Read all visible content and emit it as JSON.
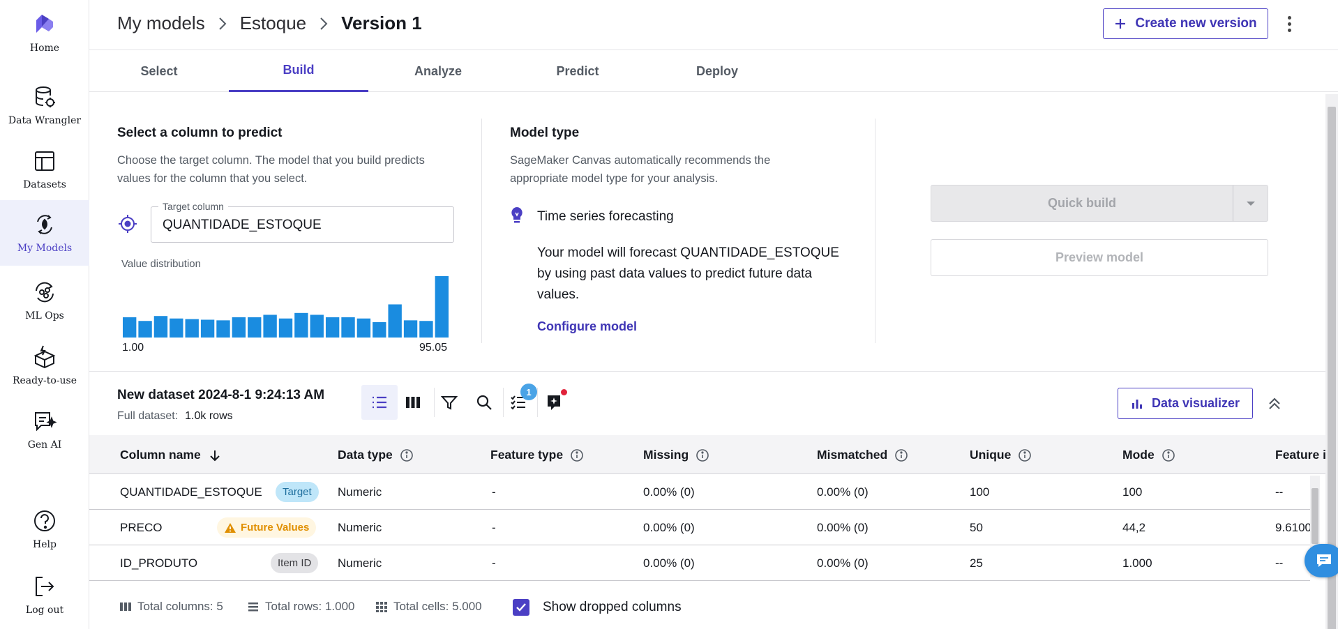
{
  "nav": {
    "items": [
      {
        "label": "Home",
        "icon": "home-logo-icon"
      },
      {
        "label": "Data Wrangler",
        "icon": "data-wrangler-icon"
      },
      {
        "label": "Datasets",
        "icon": "datasets-icon"
      },
      {
        "label": "My Models",
        "icon": "my-models-icon",
        "active": true
      },
      {
        "label": "ML Ops",
        "icon": "ml-ops-icon"
      },
      {
        "label": "Ready-to-use",
        "icon": "ready-to-use-icon"
      },
      {
        "label": "Gen AI",
        "icon": "gen-ai-icon"
      },
      {
        "label": "Help",
        "icon": "help-icon"
      },
      {
        "label": "Log out",
        "icon": "logout-icon"
      }
    ]
  },
  "header": {
    "breadcrumb": [
      "My models",
      "Estoque",
      "Version 1"
    ],
    "create_button": "Create new version"
  },
  "tabs": [
    "Select",
    "Build",
    "Analyze",
    "Predict",
    "Deploy"
  ],
  "active_tab": "Build",
  "predict_panel": {
    "title": "Select a column to predict",
    "description": "Choose the target column. The model that you build predicts values for the column that you select.",
    "target_label": "Target column",
    "target_value": "QUANTIDADE_ESTOQUE",
    "distribution_label": "Value distribution",
    "min": "1.00",
    "max": "95.05",
    "histogram": [
      0.33,
      0.27,
      0.35,
      0.31,
      0.3,
      0.29,
      0.28,
      0.33,
      0.33,
      0.37,
      0.31,
      0.4,
      0.37,
      0.33,
      0.33,
      0.31,
      0.25,
      0.54,
      0.28,
      0.27,
      1.0
    ]
  },
  "model_type_panel": {
    "title": "Model type",
    "description": "SageMaker Canvas automatically recommends the appropriate model type for your analysis.",
    "type_name": "Time series forecasting",
    "type_description": "Your model will forecast QUANTIDADE_ESTOQUE by using past data values to predict future data values.",
    "configure_link": "Configure model"
  },
  "build_panel": {
    "quick_build": "Quick build",
    "preview_model": "Preview model"
  },
  "dataset": {
    "title": "New dataset 2024-8-1 9:24:13 AM",
    "full_label": "Full dataset:",
    "full_value": "1.0k rows",
    "notification_count": "1",
    "data_visualizer": "Data visualizer"
  },
  "table": {
    "columns": [
      "Column name",
      "Data type",
      "Feature type",
      "Missing",
      "Mismatched",
      "Unique",
      "Mode",
      "Feature i"
    ],
    "rows": [
      {
        "name": "QUANTIDADE_ESTOQUE",
        "tag": "Target",
        "tag_kind": "target",
        "data_type": "Numeric",
        "feature_type": "-",
        "missing": "0.00% (0)",
        "mismatched": "0.00% (0)",
        "unique": "100",
        "mode": "100",
        "feature": "--"
      },
      {
        "name": "PRECO",
        "tag": "Future Values",
        "tag_kind": "future",
        "data_type": "Numeric",
        "feature_type": "-",
        "missing": "0.00% (0)",
        "mismatched": "0.00% (0)",
        "unique": "50",
        "mode": "44,2",
        "feature": "9.6100"
      },
      {
        "name": "ID_PRODUTO",
        "tag": "Item ID",
        "tag_kind": "itemid",
        "data_type": "Numeric",
        "feature_type": "-",
        "missing": "0.00% (0)",
        "mismatched": "0.00% (0)",
        "unique": "25",
        "mode": "1.000",
        "feature": "--"
      }
    ]
  },
  "footer": {
    "total_columns": "Total columns: 5",
    "total_rows": "Total rows: 1.000",
    "total_cells": "Total cells: 5.000",
    "show_dropped": "Show dropped columns",
    "show_dropped_checked": true
  },
  "colors": {
    "accent": "#4b3fc4",
    "histogram_bar": "#1a8ce0",
    "target_tag_bg": "#bfe6f9",
    "future_tag_text": "#e08f00"
  }
}
